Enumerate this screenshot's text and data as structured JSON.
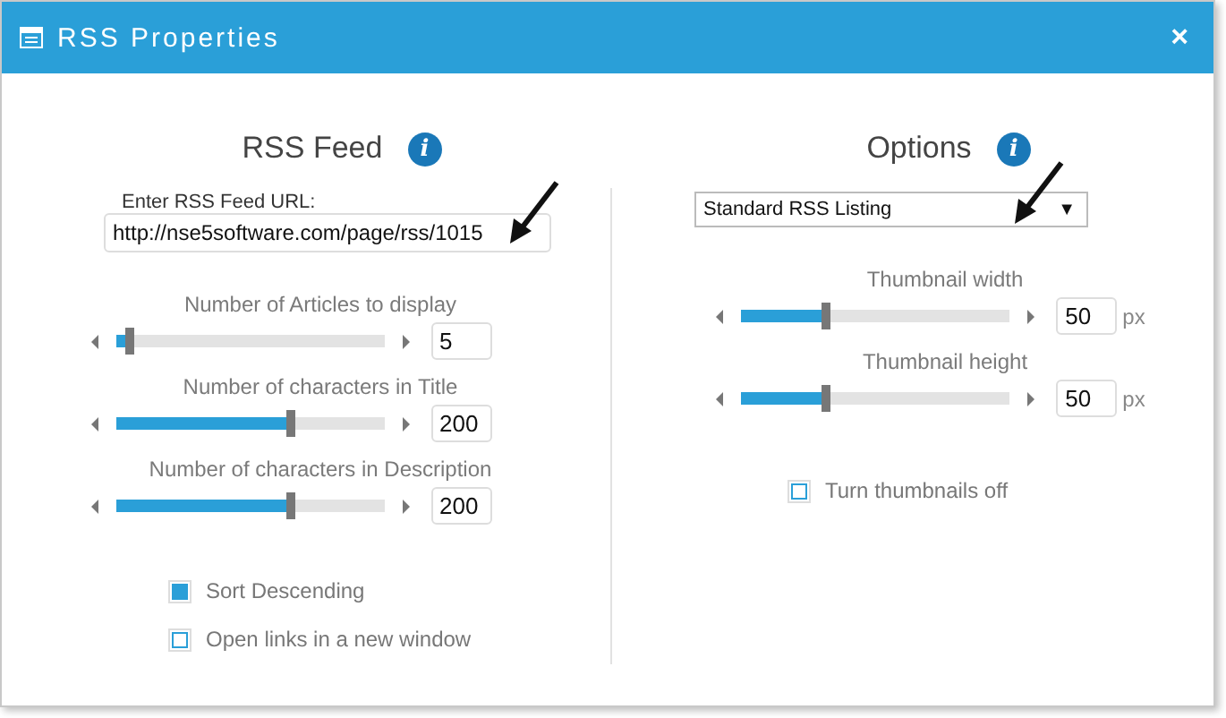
{
  "window": {
    "title": "RSS Properties",
    "close": "×"
  },
  "rss_feed": {
    "heading": "RSS Feed",
    "info": "i",
    "url_label": "Enter RSS Feed URL:",
    "url": "http://nse5software.com/page/rss/1015",
    "sliders": [
      {
        "label": "Number of Articles to display",
        "level": 0.05,
        "value": "5"
      },
      {
        "label": "Number of characters in Title",
        "level": 0.65,
        "value": "200"
      },
      {
        "label": "Number of characters in Description",
        "level": 0.65,
        "value": "200"
      }
    ],
    "checkboxes": [
      {
        "label": "Sort Descending",
        "checked": true
      },
      {
        "label": "Open links in a new window",
        "checked": false
      }
    ]
  },
  "options": {
    "heading": "Options",
    "info": "i",
    "listing": {
      "value": "Standard RSS Listing",
      "caret": "▼"
    },
    "sliders": [
      {
        "label": "Thumbnail width",
        "level": 0.31,
        "value": "50",
        "unit": "px"
      },
      {
        "label": "Thumbnail height",
        "level": 0.31,
        "value": "50",
        "unit": "px"
      }
    ],
    "checkboxes": [
      {
        "label": "Turn thumbnails off",
        "checked": false
      }
    ]
  }
}
